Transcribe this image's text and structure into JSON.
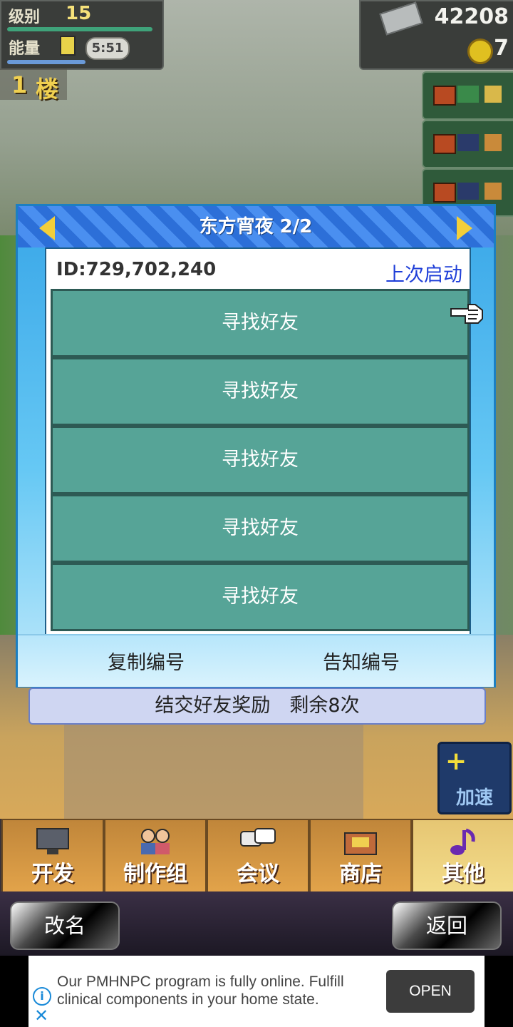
{
  "hud": {
    "level_label": "级别",
    "level_value": "15",
    "energy_label": "能量",
    "energy_value": "1",
    "timer": "5:51",
    "floor_num": "1",
    "floor_unit": "楼",
    "money": "42208",
    "coins": "7"
  },
  "dialog": {
    "title": "东方宵夜 2/2",
    "id_text": "ID:729,702,240",
    "last_launch": "上次启动",
    "friend_slots": [
      "寻找好友",
      "寻找好友",
      "寻找好友",
      "寻找好友",
      "寻找好友"
    ],
    "copy_label": "复制编号",
    "notify_label": "告知编号"
  },
  "reward": {
    "text": "结交好友奖励　剩余8次"
  },
  "speed_button": {
    "label": "加速"
  },
  "menu": [
    {
      "label": "开发"
    },
    {
      "label": "制作组"
    },
    {
      "label": "会议"
    },
    {
      "label": "商店"
    },
    {
      "label": "其他"
    }
  ],
  "bottom": {
    "rename_label": "改名",
    "back_label": "返回"
  },
  "ad": {
    "text": "Our PMHNPC program is fully online. Fulfill clinical components in your home state.",
    "open_label": "OPEN"
  },
  "colors": {
    "dialog_blue": "#38a6e8",
    "slot_teal": "#56a497",
    "link_blue": "#1e3ed8",
    "gold": "#f2cf3a"
  }
}
